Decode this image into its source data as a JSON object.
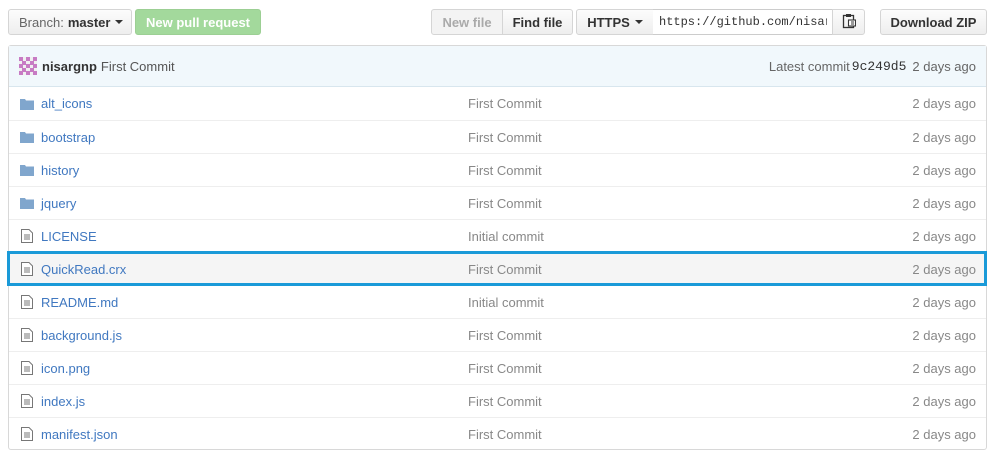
{
  "toolbar": {
    "branch_prefix": "Branch:",
    "branch_name": "master",
    "new_pr_label": "New pull request",
    "new_file_label": "New file",
    "find_file_label": "Find file",
    "protocol_label": "HTTPS",
    "clone_url": "https://github.com/nisargnp/QuickRead.git",
    "copy_icon": "clipboard-icon",
    "download_zip_label": "Download ZIP"
  },
  "commit": {
    "author": "nisargnp",
    "message": "First Commit",
    "latest_label": "Latest commit",
    "sha": "9c249d5",
    "age": "2 days ago"
  },
  "files": [
    {
      "name": "alt_icons",
      "type": "dir",
      "icon": "folder-icon",
      "message": "First Commit",
      "age": "2 days ago"
    },
    {
      "name": "bootstrap",
      "type": "dir",
      "icon": "folder-icon",
      "message": "First Commit",
      "age": "2 days ago"
    },
    {
      "name": "history",
      "type": "dir",
      "icon": "folder-icon",
      "message": "First Commit",
      "age": "2 days ago"
    },
    {
      "name": "jquery",
      "type": "dir",
      "icon": "folder-icon",
      "message": "First Commit",
      "age": "2 days ago"
    },
    {
      "name": "LICENSE",
      "type": "file",
      "icon": "file-icon",
      "message": "Initial commit",
      "age": "2 days ago"
    },
    {
      "name": "QuickRead.crx",
      "type": "file",
      "icon": "file-icon",
      "message": "First Commit",
      "age": "2 days ago",
      "selected": true
    },
    {
      "name": "README.md",
      "type": "file",
      "icon": "file-icon",
      "message": "Initial commit",
      "age": "2 days ago"
    },
    {
      "name": "background.js",
      "type": "file",
      "icon": "file-icon",
      "message": "First Commit",
      "age": "2 days ago"
    },
    {
      "name": "icon.png",
      "type": "file",
      "icon": "file-icon",
      "message": "First Commit",
      "age": "2 days ago"
    },
    {
      "name": "index.js",
      "type": "file",
      "icon": "file-icon",
      "message": "First Commit",
      "age": "2 days ago"
    },
    {
      "name": "manifest.json",
      "type": "file",
      "icon": "file-icon",
      "message": "First Commit",
      "age": "2 days ago"
    }
  ],
  "colors": {
    "link": "#4078c0",
    "highlight": "#1a9ad8",
    "folder": "#80a6cd",
    "new_pr_button": "#a3d99c"
  }
}
